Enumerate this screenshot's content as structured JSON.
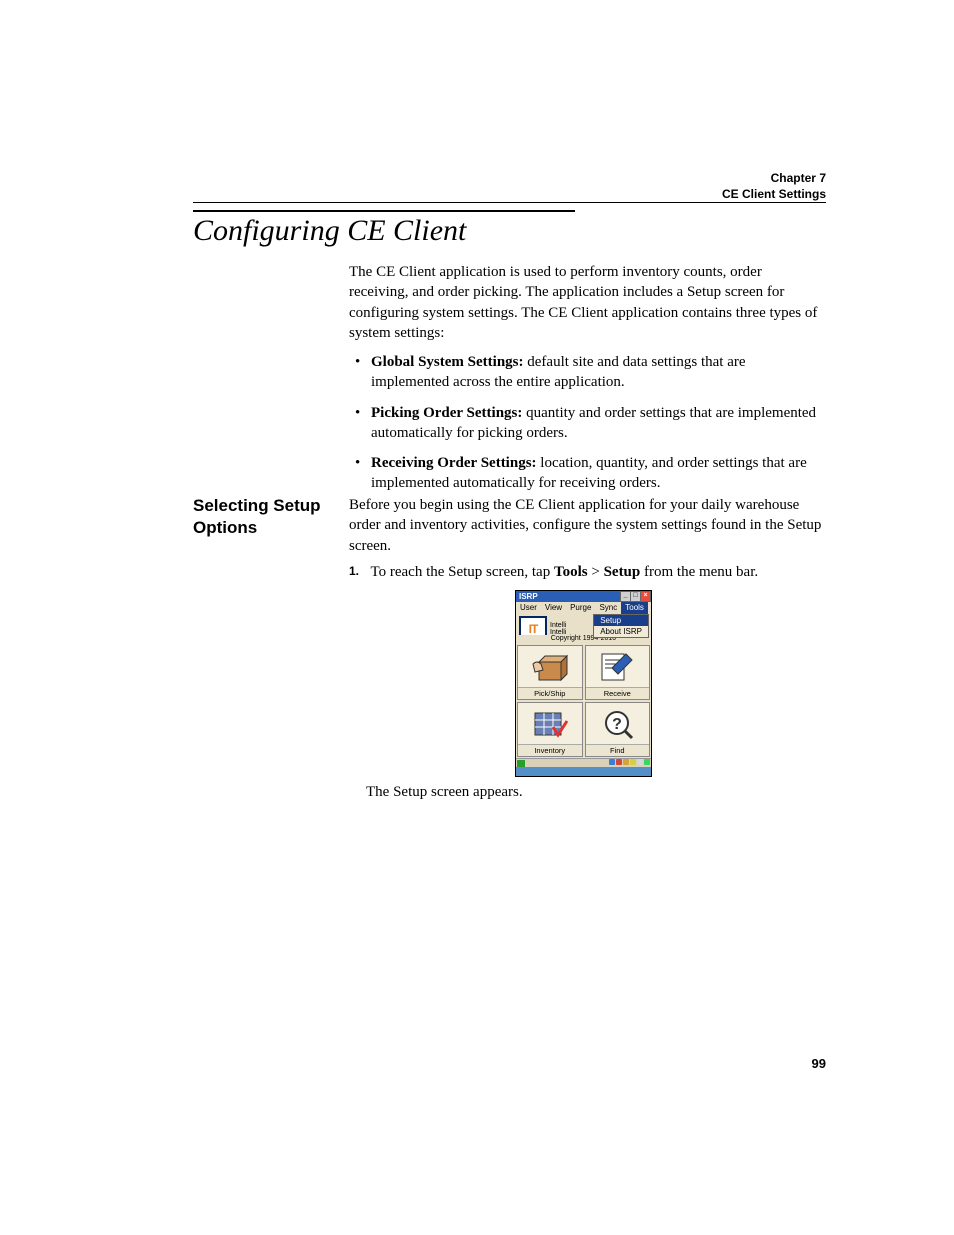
{
  "header": {
    "chapter": "Chapter 7",
    "subtitle": "CE Client Settings"
  },
  "title": "Configuring CE Client",
  "intro": "The CE Client application is used to perform inventory counts, order receiving, and order picking. The application includes a Setup screen for configuring system settings. The CE Client application contains three types of system settings:",
  "bullets": [
    {
      "lead": "Global System Settings:",
      "rest": " default site and data settings that are implemented across the entire application."
    },
    {
      "lead": "Picking Order Settings:",
      "rest": " quantity and order settings that are implemented automatically for picking orders."
    },
    {
      "lead": "Receiving Order Settings:",
      "rest": " location, quantity, and order settings that are implemented automatically for receiving orders."
    }
  ],
  "side_heading": "Selecting Setup Options",
  "para2": "Before you begin using the CE Client application for your daily warehouse order and inventory activities, configure the system settings found in the Setup screen.",
  "step": {
    "num": "1.",
    "pre": "To reach the Setup screen, tap ",
    "b1": "Tools",
    "mid": " > ",
    "b2": "Setup",
    "post": " from the menu bar."
  },
  "screenshot": {
    "window_title": "ISRP",
    "menus": [
      "User",
      "View",
      "Purge",
      "Sync",
      "Tools"
    ],
    "active_menu_index": 4,
    "dropdown": {
      "items": [
        "Setup",
        "About ISRP"
      ],
      "highlighted": 0
    },
    "logo_lines": [
      "Intelli",
      "Intelli"
    ],
    "copyright": "Copyright 1994-2010",
    "cells": [
      "Pick/Ship",
      "Receive",
      "Inventory",
      "Find"
    ]
  },
  "after_screenshot": "The Setup screen appears.",
  "page_number": "99"
}
